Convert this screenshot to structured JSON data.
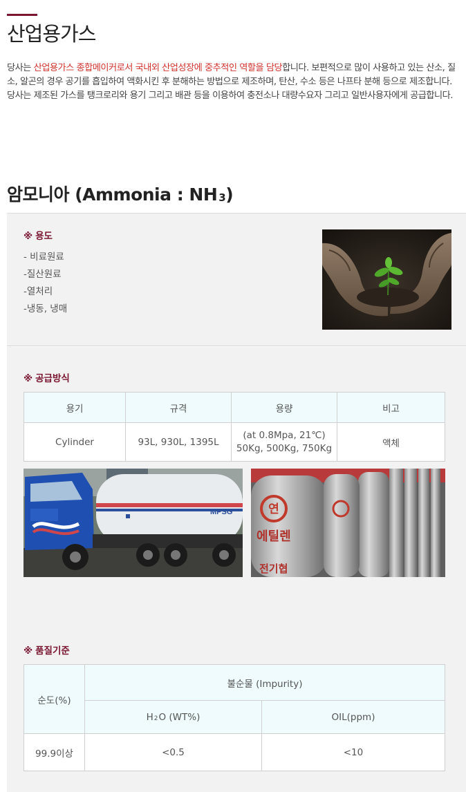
{
  "page": {
    "title": "산업용가스"
  },
  "intro": {
    "p1_a": "당사는 ",
    "p1_highlight": "산업용가스 종합메이커로서 국내외 산업성장에 중추적인 역할을 담당",
    "p1_b": "합니다. 보편적으로 많이 사용하고 있는 산소, 질소, 알곤의 경우 공기를 흡입하여 액화시킨 후 분해하는 방법으로 제조하며, 탄산, 수소 등은 나프타 분해 등으로 제조합니다.",
    "p2": "당사는 제조된 가스를 탱크로리와 용기 그리고 배관 등을 이용하여 충전소나 대량수요자 그리고 일반사용자에게 공급합니다."
  },
  "gas": {
    "title_main": "암모니아 (Ammonia : NH",
    "title_sub": "3",
    "title_end": ")"
  },
  "usage": {
    "mark": "※",
    "heading": "용도",
    "items": [
      "- 비료원료",
      "-질산원료",
      "-열처리",
      "-냉동, 냉매"
    ],
    "photo_icon": "hands-soil-seedling-photo"
  },
  "supply": {
    "mark": "※",
    "heading": "공급방식",
    "headers": [
      "용기",
      "규격",
      "용량",
      "비고"
    ],
    "row": {
      "container": "Cylinder",
      "spec": "93L, 930L, 1395L",
      "capacity_line1": "(at 0.8Mpa, 21℃)",
      "capacity_line2": "50Kg, 500Kg, 750Kg",
      "note": "액체"
    },
    "truck_label": "MPSG",
    "cylinder_label_circle": "연",
    "cylinder_label_text": "에틸렌",
    "cylinder_label_bottom": "전기협"
  },
  "quality": {
    "mark": "※",
    "heading": "품질기준",
    "purity_header": "순도(%)",
    "impurity_header": "불순물 (Impurity)",
    "h2o_header_a": "H",
    "h2o_header_sub": "2",
    "h2o_header_b": "O (WT%)",
    "oil_header": "OIL(ppm)",
    "purity_value": "99.9이상",
    "h2o_value": "<0.5",
    "oil_value": "<10"
  },
  "colors": {
    "accent": "#7a1530",
    "highlight": "#d0312d",
    "panel_bg": "#f2f2f2",
    "table_header_bg": "#effbfc"
  }
}
